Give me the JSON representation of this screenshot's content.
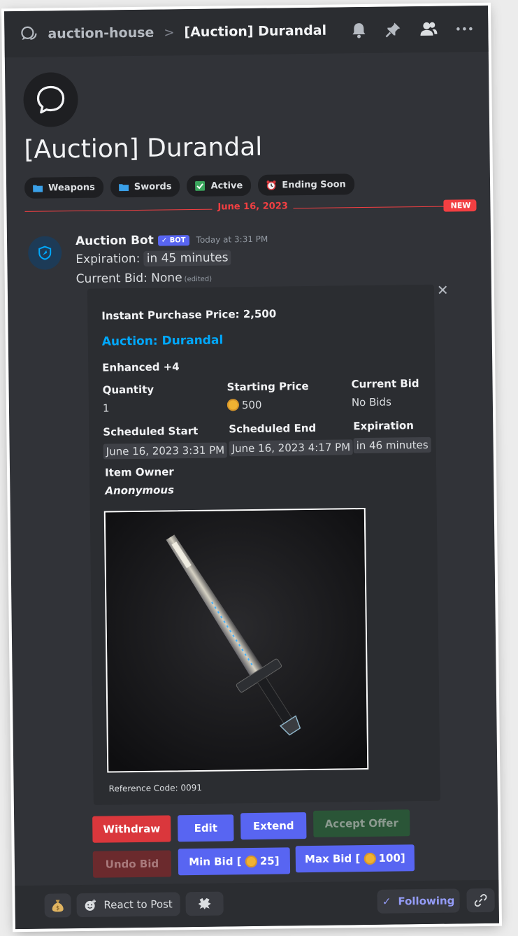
{
  "header": {
    "channel": "auction-house",
    "separator": ">",
    "thread_title": "[Auction] Durandal",
    "icons": [
      "threads-icon",
      "bell-icon",
      "pin-icon",
      "members-icon",
      "more-icon"
    ]
  },
  "post": {
    "title": "[Auction] Durandal",
    "tags": [
      {
        "icon": "folder-icon",
        "label": "Weapons"
      },
      {
        "icon": "folder-icon",
        "label": "Swords"
      },
      {
        "icon": "check-icon",
        "label": "Active"
      },
      {
        "icon": "alarm-clock-icon",
        "label": "Ending Soon"
      }
    ],
    "divider_date": "June 16, 2023",
    "new_badge": "NEW"
  },
  "message": {
    "author": "Auction Bot",
    "bot_tag": "✓ BOT",
    "timestamp": "Today at 3:31 PM",
    "expiration_label": "Expiration:",
    "expiration_value": "in 45 minutes",
    "current_bid_label": "Current Bid: None",
    "edited": "(edited)"
  },
  "embed": {
    "close": "✕",
    "instant_purchase": "Instant Purchase Price: 2,500",
    "title": "Auction: Durandal",
    "subtitle": "Enhanced +4",
    "quantity_label": "Quantity",
    "quantity_value": "1",
    "starting_price_label": "Starting Price",
    "starting_price_value": "500",
    "current_bid_label": "Current Bid",
    "current_bid_value": "No Bids",
    "scheduled_start_label": "Scheduled Start",
    "scheduled_start_value": "June 16, 2023 3:31 PM",
    "scheduled_end_label": "Scheduled End",
    "scheduled_end_value": "June 16, 2023 4:17 PM",
    "expiration_label": "Expiration",
    "expiration_value": "in 46 minutes",
    "owner_label": "Item Owner",
    "owner_value": "Anonymous",
    "reference": "Reference Code: 0091"
  },
  "buttons": {
    "withdraw": "Withdraw",
    "edit": "Edit",
    "extend": "Extend",
    "accept_offer": "Accept Offer",
    "undo_bid": "Undo Bid",
    "min_bid_prefix": "Min Bid [",
    "min_bid_value": "25]",
    "max_bid_prefix": "Max Bid [",
    "max_bid_value": "100]"
  },
  "footer": {
    "react": "React to Post",
    "following": "Following",
    "following_check": "✓"
  },
  "colors": {
    "background": "#313338",
    "header": "#2b2d31",
    "accent_blue": "#5865f2",
    "danger_red": "#da373c",
    "link_blue": "#00a8fc",
    "new_red": "#f23f42"
  }
}
